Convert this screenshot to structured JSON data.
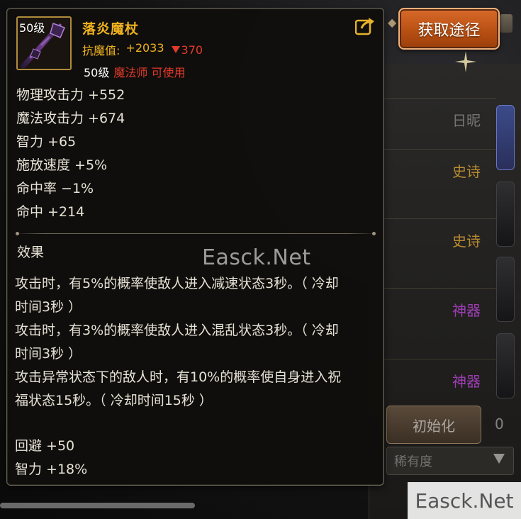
{
  "item": {
    "level_tag": "50级",
    "name": "落炎魔杖",
    "resist_label": "抗魔值:",
    "resist_value": "+2033",
    "resist_down": "370",
    "usable_level": "50级",
    "usable_class": "魔法师 可使用",
    "name_color": "#f0b21f",
    "down_color": "#e33a2a"
  },
  "stats": [
    "物理攻击力 +552",
    "魔法攻击力 +674",
    "智力 +65",
    "施放速度 +5%",
    "命中率 −1%",
    "命中 +214"
  ],
  "effects": {
    "title": "效果",
    "lines": [
      "攻击时，有5%的概率使敌人进入减速状态3秒。（ 冷却",
      "时间3秒 ）",
      "攻击时，有3%的概率使敌人进入混乱状态3秒。（ 冷却",
      "时间3秒 ）",
      "攻击异常状态下的敌人时，有10%的概率使自身进入祝",
      "福状态15秒。（ 冷却时间15秒 ）"
    ]
  },
  "extra_stats": [
    "回避 +50",
    "智力 +18%"
  ],
  "buttons": {
    "get_way": "获取途径",
    "get_way_color": "#c85a1c"
  },
  "background": {
    "rows": [
      {
        "text": "日昵",
        "style": "gray"
      },
      {
        "text": "史诗",
        "style": "gold"
      },
      {
        "text": "史诗",
        "style": "gold"
      },
      {
        "text": "神器",
        "style": "purple"
      },
      {
        "text": "神器",
        "style": "purple"
      }
    ],
    "init_button": "初始化",
    "rare_select": "稀有度",
    "side_number": "0"
  },
  "watermark": "Easck.Net",
  "corner_watermark": "Easck.Net",
  "icons": {
    "share": "share-icon",
    "down": "down-triangle-icon",
    "staff": "staff-icon"
  }
}
